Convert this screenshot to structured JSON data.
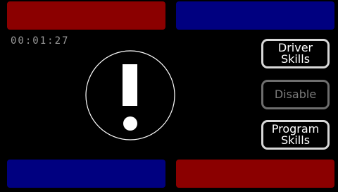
{
  "timer": "00:01:27",
  "buttons": {
    "driver_skills": [
      "Driver",
      "Skills"
    ],
    "disable": "Disable",
    "program_skills": [
      "Program",
      "Skills"
    ]
  },
  "colors": {
    "red_alliance": "#8b0000",
    "blue_alliance": "#000080",
    "background": "#000000",
    "alert_white": "#ffffff"
  },
  "icons": {
    "alert": "exclamation-icon"
  }
}
